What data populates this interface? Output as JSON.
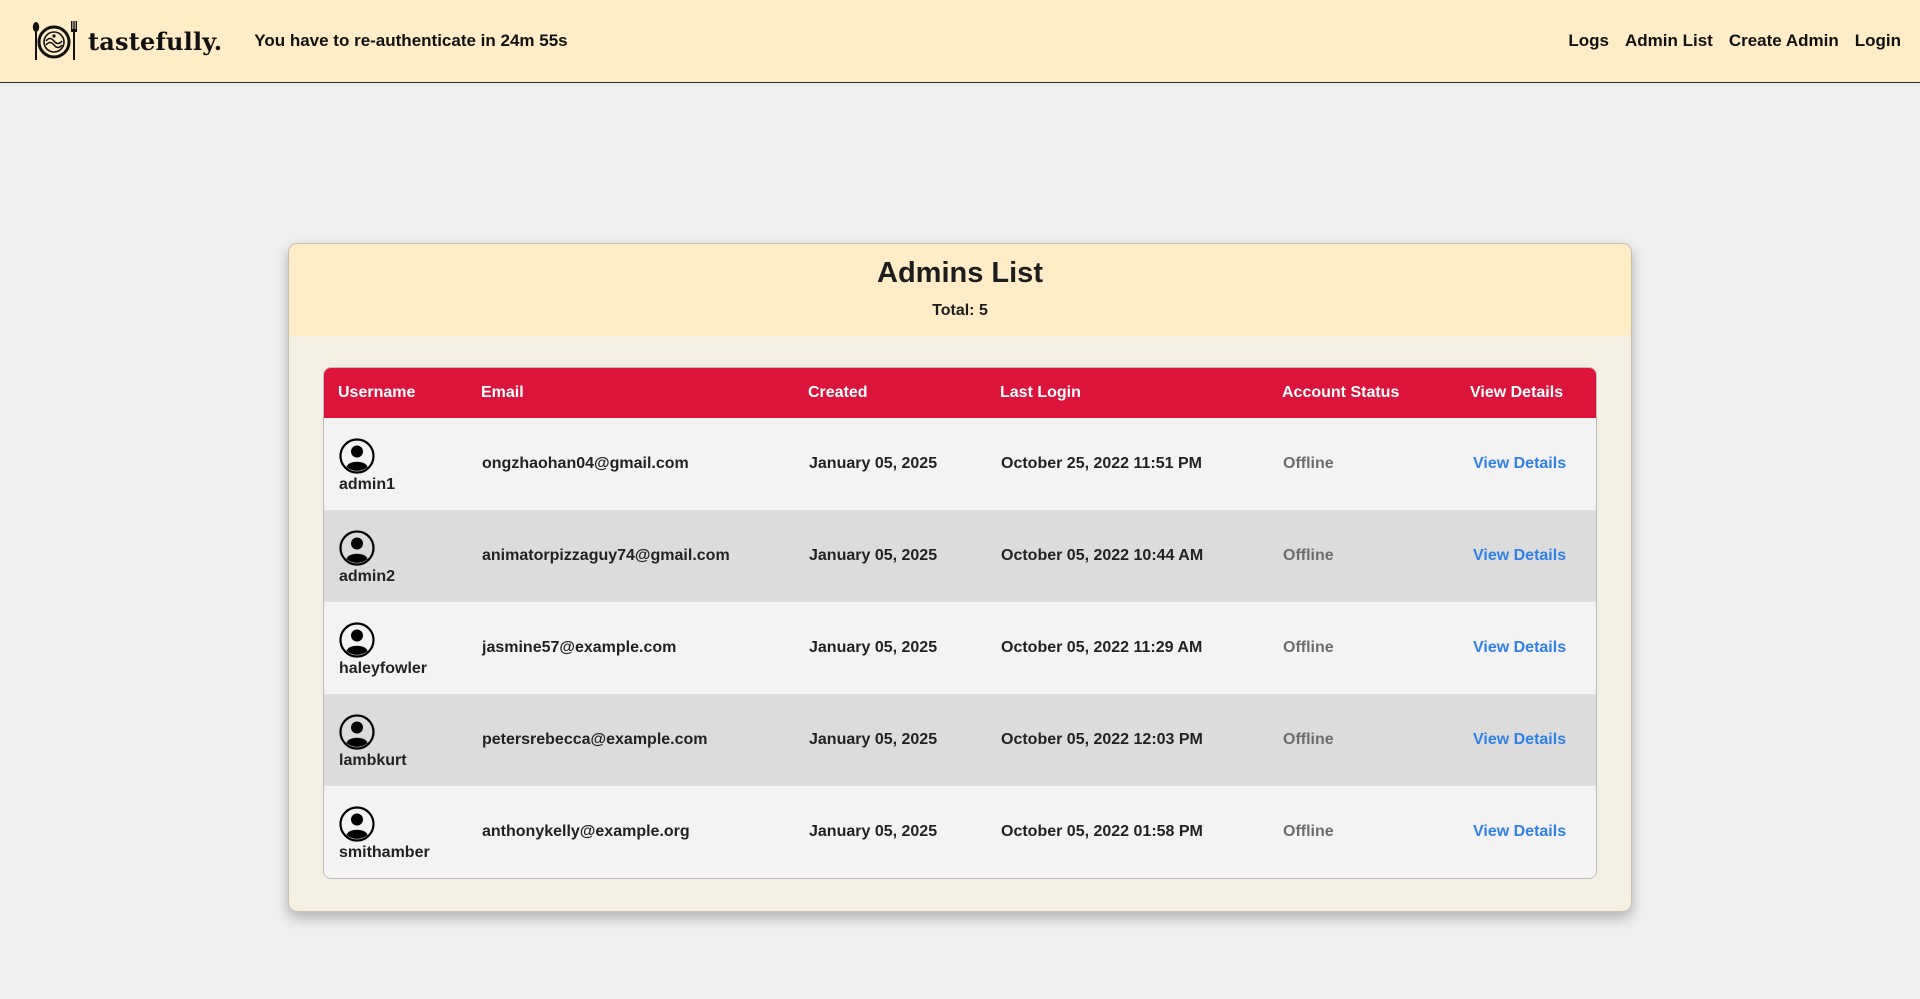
{
  "navbar": {
    "brand": "tastefully.",
    "logo_icon": "plate-cutlery-icon",
    "reauth_text": "You have to re-authenticate in 24m 55s",
    "links": [
      "Logs",
      "Admin List",
      "Create Admin",
      "Login"
    ]
  },
  "card": {
    "title": "Admins List",
    "total": "Total: 5"
  },
  "table": {
    "headers": [
      "Username",
      "Email",
      "Created",
      "Last Login",
      "Account Status",
      "View Details"
    ],
    "rows": [
      {
        "username": "admin1",
        "email": "ongzhaohan04@gmail.com",
        "created": "January 05, 2025",
        "last_login": "October 25, 2022 11:51 PM",
        "status": "Offline",
        "details": "View Details"
      },
      {
        "username": "admin2",
        "email": "animatorpizzaguy74@gmail.com",
        "created": "January 05, 2025",
        "last_login": "October 05, 2022 10:44 AM",
        "status": "Offline",
        "details": "View Details"
      },
      {
        "username": "haleyfowler",
        "email": "jasmine57@example.com",
        "created": "January 05, 2025",
        "last_login": "October 05, 2022 11:29 AM",
        "status": "Offline",
        "details": "View Details"
      },
      {
        "username": "lambkurt",
        "email": "petersrebecca@example.com",
        "created": "January 05, 2025",
        "last_login": "October 05, 2022 12:03 PM",
        "status": "Offline",
        "details": "View Details"
      },
      {
        "username": "smithamber",
        "email": "anthonykelly@example.org",
        "created": "January 05, 2025",
        "last_login": "October 05, 2022 01:58 PM",
        "status": "Offline",
        "details": "View Details"
      }
    ]
  },
  "colors": {
    "navbar_bg": "#feedc6",
    "header_red": "#dc143c",
    "link_blue": "#2f80e8",
    "status_gray": "#6d6d6d"
  }
}
